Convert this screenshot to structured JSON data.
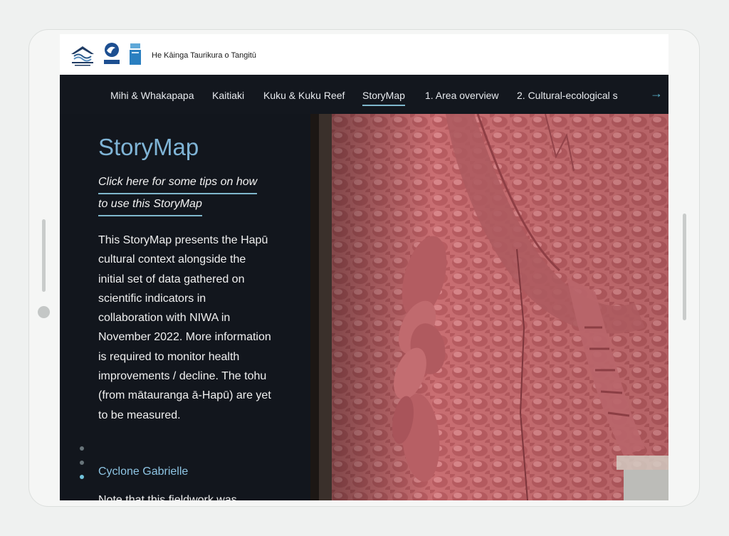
{
  "header": {
    "site_title": "He Kāinga Taurikura o Tangitū",
    "logos": [
      "hapu-logo",
      "niwa-logo",
      "award-badge"
    ]
  },
  "nav": {
    "items": [
      {
        "label": "Mihi & Whakapapa"
      },
      {
        "label": "Kaitiaki"
      },
      {
        "label": "Kuku & Kuku Reef"
      },
      {
        "label": "StoryMap",
        "active": true
      },
      {
        "label": "1. Area overview"
      },
      {
        "label": "2. Cultural-ecological s"
      }
    ],
    "next_icon": "arrow-right-icon"
  },
  "panel": {
    "title": "StoryMap",
    "tips_link_line1": "Click here for some tips on how",
    "tips_link_line2": "to use this StoryMap",
    "paragraph": "This StoryMap presents the Hapū cultural context alongside the initial set of data gathered on scientific indicators in collaboration with NIWA in November 2022. More information is required to monitor health improvements / decline.  The tohu (from mātauranga ā-Hapū) are yet to be measured.",
    "section_link": "Cyclone Gabrielle",
    "cut_text": "Note that this fieldwork was"
  },
  "colors": {
    "accent": "#7fb7cc",
    "title": "#7fb4d6",
    "background": "#12161d",
    "carving": "#c86a6e"
  }
}
